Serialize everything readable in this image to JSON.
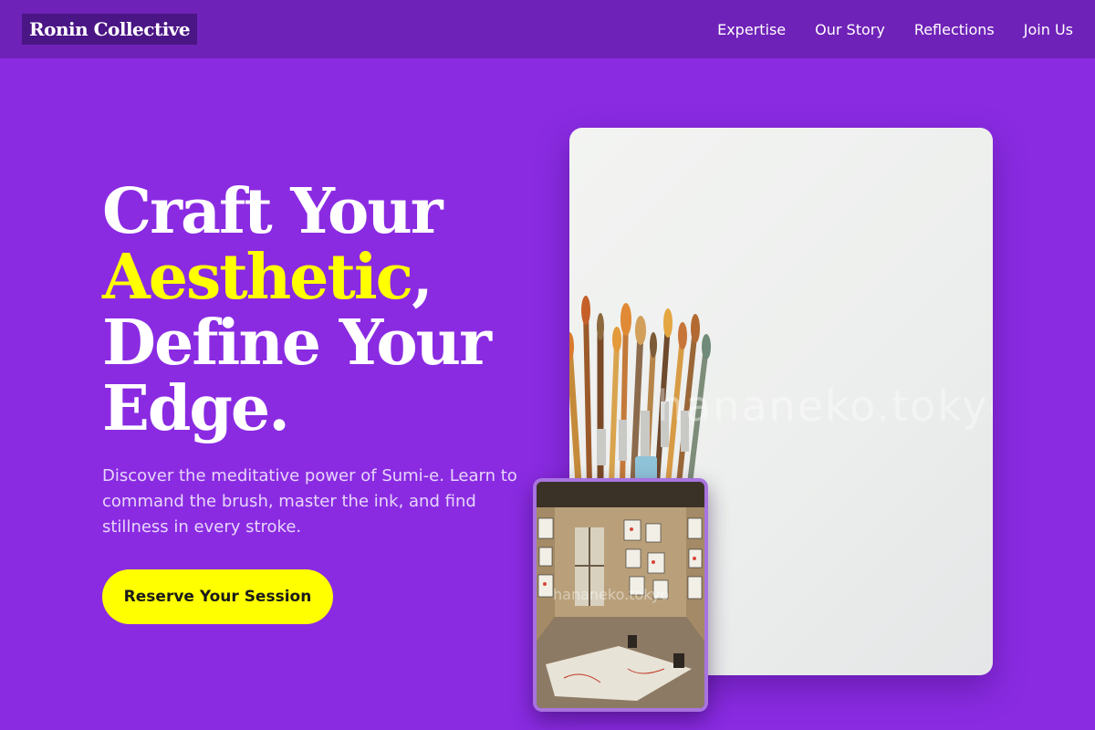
{
  "header": {
    "logo": "Ronin Collective",
    "nav": [
      "Expertise",
      "Our Story",
      "Reflections",
      "Join Us"
    ]
  },
  "hero": {
    "title_line1": "Craft Your",
    "title_accent": "Aesthetic",
    "title_comma": ",",
    "title_line3": "Define Your",
    "title_line4": "Edge.",
    "subtitle": "Discover the meditative power of Sumi-e. Learn to command the brush, master the ink, and find stillness in every stroke.",
    "cta_label": "Reserve Your Session"
  },
  "images": {
    "main_watermark": "hananeko.tokyo",
    "inset_watermark": "hananeko.tokyo"
  },
  "colors": {
    "background": "#8a2be2",
    "header": "#6f22b8",
    "accent": "#ffff00"
  }
}
